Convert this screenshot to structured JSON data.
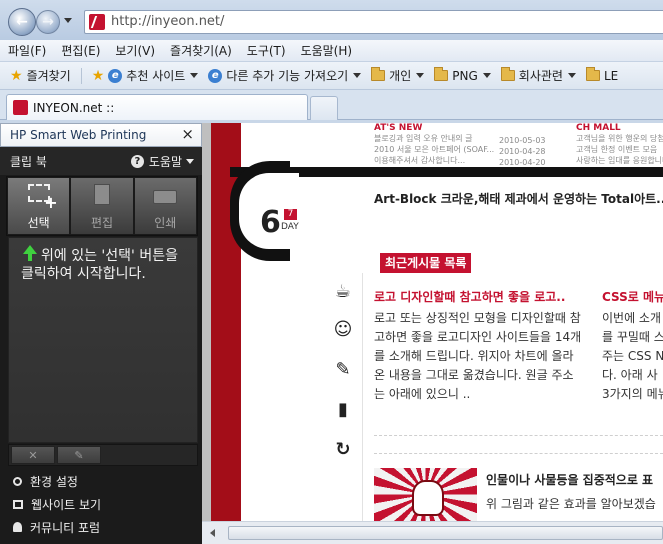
{
  "browser": {
    "url": "http://inyeon.net/",
    "menu": [
      "파일(F)",
      "편집(E)",
      "보기(V)",
      "즐겨찾기(A)",
      "도구(T)",
      "도움말(H)"
    ],
    "favorites_label": "즐겨찾기",
    "favorites_bar": {
      "recommended_sites": "추천 사이트",
      "more_addons": "다른 추가 기능 가져오기",
      "folders": [
        "개인",
        "PNG",
        "회사관련",
        "LE"
      ]
    },
    "tab_title": "INYEON.net ::"
  },
  "hp_panel": {
    "title": "HP Smart Web Printing",
    "close": "×",
    "clipbook": "클립 북",
    "help": "도움말",
    "tools": [
      {
        "label": "선택",
        "icon": "select-icon"
      },
      {
        "label": "편집",
        "icon": "edit-icon"
      },
      {
        "label": "인쇄",
        "icon": "print-icon"
      }
    ],
    "hint": "위에 있는 '선택' 버튼을 클릭하여 시작합니다.",
    "actions": [
      "✕",
      "✎"
    ],
    "links": [
      {
        "label": "환경 설정",
        "icon": "settings-icon"
      },
      {
        "label": "웹사이트 보기",
        "icon": "website-icon"
      },
      {
        "label": "커뮤니티 포럼",
        "icon": "forum-icon"
      }
    ]
  },
  "page": {
    "date": {
      "number": "6",
      "badge": "7",
      "day": "DAY"
    },
    "news_left": {
      "head": "AT'S NEW",
      "lines": [
        "블로깅과 입력 오유 안내의 글",
        "2010 서울 모은 아트페어 (SOAF...",
        "이용해주셔서 감사합니다..."
      ],
      "dates": [
        "2010-05-03",
        "2010-04-28",
        "2010-04-20"
      ]
    },
    "news_right": {
      "head": "CH MALL",
      "lines": [
        "고객님을 위한 행운의 당첨",
        "고객님 한정 이벤트 모음",
        "사랑하는 임대를 응원합니다"
      ]
    },
    "ad_line": "Art-Block 크라운,해태 제과에서 운영하는 Total아트..",
    "recent_label": "최근게시물 목록",
    "posts": [
      {
        "title": "로고 디자인할때 참고하면 좋을 로고..",
        "body": "로고 또는 상징적인 모형을 디자인할때 참고하면 좋을 로고디자인 사이트들을 14개를 소개해 드립니다. 위지아 차트에 올라온 내용을 그대로 옮겼습니다. 원글 주소는 아래에 있으니 .."
      },
      {
        "title": "CSS로 메뉴",
        "body_lines": [
          "이번에 소개",
          "를 꾸밀때 스",
          "주는 CSS N",
          "다. 아래 사",
          "3가지의 메뉴"
        ]
      },
      {
        "title": "인물이나 사물등을 집중적으로 표",
        "body": "위 그림과 같은 효과를 알아보겠습"
      }
    ],
    "side_icons": [
      "coffee-icon",
      "headset-icon",
      "pencil-icon",
      "bookmark-icon",
      "refresh-icon"
    ]
  }
}
